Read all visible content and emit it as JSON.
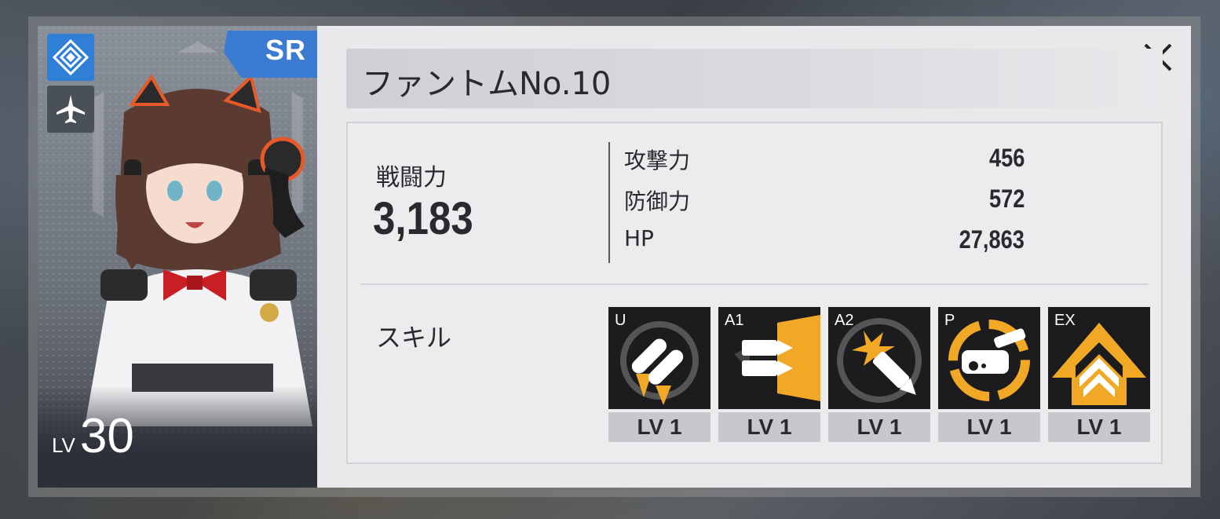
{
  "character": {
    "name": "ファントムNo.10",
    "rarity": "SR",
    "level_prefix": "LV",
    "level": "30",
    "type_icon": "diamond-emblem-icon",
    "role_icon": "airplane-icon",
    "accent_color": "#2f7fd6"
  },
  "stats": {
    "power_label": "戦闘力",
    "power_value": "3,183",
    "items": [
      {
        "label": "攻撃力",
        "value": "456"
      },
      {
        "label": "防御力",
        "value": "572"
      },
      {
        "label": "HP",
        "value": "27,863"
      }
    ]
  },
  "skills": {
    "label": "スキル",
    "items": [
      {
        "tag": "U",
        "level": "LV 1",
        "icon": "twin-missiles-icon"
      },
      {
        "tag": "A1",
        "level": "LV 1",
        "icon": "bullets-burst-icon"
      },
      {
        "tag": "A2",
        "level": "LV 1",
        "icon": "bullet-explosion-icon"
      },
      {
        "tag": "P",
        "level": "LV 1",
        "icon": "turret-target-icon"
      },
      {
        "tag": "EX",
        "level": "LV 1",
        "icon": "chevron-rank-icon"
      }
    ],
    "icon_color": "#f0a825"
  },
  "close_icon": "close-icon"
}
